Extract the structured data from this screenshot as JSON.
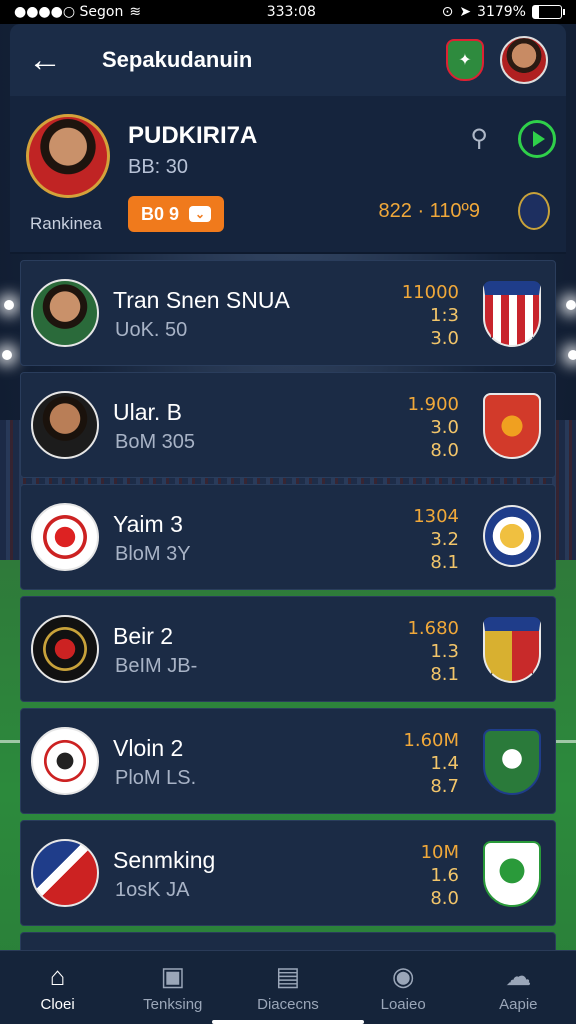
{
  "status": {
    "carrier": "●●●●○ Segon",
    "time": "333:08",
    "battery": "3179%"
  },
  "header": {
    "title": "Sepakudanuin"
  },
  "profile": {
    "name": "PUDKIRI7A",
    "sub": "BB: 30",
    "rank_label": "Rankinea",
    "badge": "B0 9",
    "score": "822 · 110º9"
  },
  "rows": [
    {
      "title": "Tran Snen SNUA",
      "sub": "UoK. 50",
      "stats": [
        "11000",
        "1:3",
        "3.0"
      ],
      "crest_color": "#c8242c"
    },
    {
      "title": "Ular. B",
      "sub": "BoM 305",
      "stats": [
        "1.900",
        "3.0",
        "8.0"
      ],
      "crest_color": "#d23a2a"
    },
    {
      "title": "Yaim 3",
      "sub": "BloM 3Y",
      "stats": [
        "1304",
        "3.2",
        "8.1"
      ],
      "crest_color": "#1f3d8a"
    },
    {
      "title": "Beir 2",
      "sub": "BeIM JB-",
      "stats": [
        "1.680",
        "1.3",
        "8.1"
      ],
      "crest_color": "#d8b030"
    },
    {
      "title": "Vloin 2",
      "sub": "PloM LS.",
      "stats": [
        "1.60M",
        "1.4",
        "8.7"
      ],
      "crest_color": "#2a7a3a"
    },
    {
      "title": "Senmking",
      "sub": "1osK JA",
      "stats": [
        "10M",
        "1.6",
        "8.0"
      ],
      "crest_color": "#f0f0f0"
    }
  ],
  "nav": [
    {
      "label": "Cloei",
      "icon": "home-icon"
    },
    {
      "label": "Tenksing",
      "icon": "ranking-icon"
    },
    {
      "label": "Diacecns",
      "icon": "document-icon"
    },
    {
      "label": "Loaieo",
      "icon": "ball-icon"
    },
    {
      "label": "Aapie",
      "icon": "profile-icon"
    }
  ]
}
